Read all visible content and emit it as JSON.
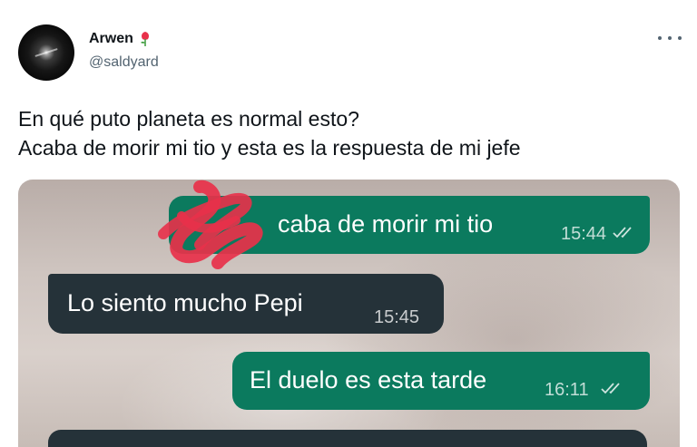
{
  "tweet": {
    "author_name": "Arwen",
    "author_handle": "@saldyard",
    "text_lines": [
      "En qué puto planeta es normal esto?",
      "Acaba de morir mi tio y esta es la respuesta de mi jefe"
    ],
    "icons": {
      "name_emoji": "rose-icon",
      "more": "more-icon"
    }
  },
  "chat": {
    "messages": [
      {
        "direction": "outgoing",
        "text": "caba de morir mi tio",
        "time": "15:44",
        "read": true
      },
      {
        "direction": "incoming",
        "text": "Lo siento mucho Pepi",
        "time": "15:45"
      },
      {
        "direction": "outgoing",
        "text": "El duelo es esta tarde",
        "time": "16:11",
        "read": true
      }
    ],
    "colors": {
      "outgoing": "#0b7a5e",
      "incoming": "#253239",
      "redaction": "#e8314a"
    }
  }
}
